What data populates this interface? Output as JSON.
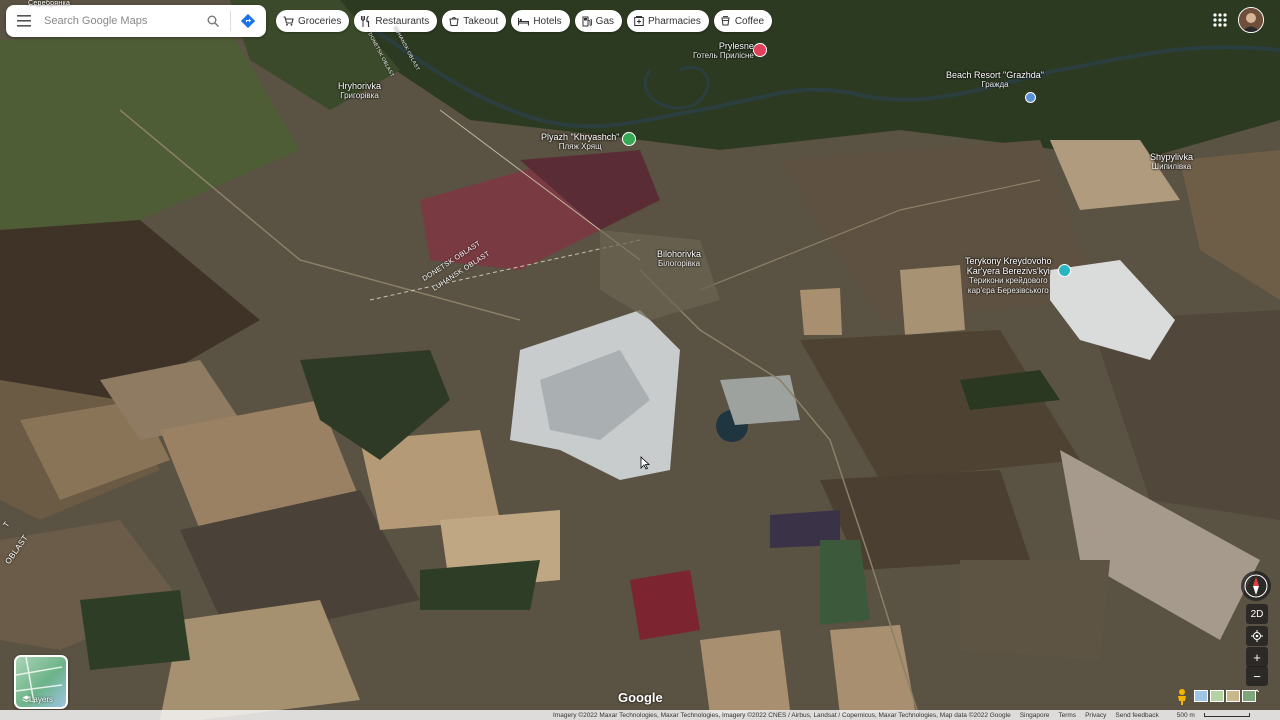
{
  "search": {
    "placeholder": "Search Google Maps"
  },
  "chips": [
    {
      "label": "Groceries",
      "icon": "cart-icon"
    },
    {
      "label": "Restaurants",
      "icon": "fork-knife-icon"
    },
    {
      "label": "Takeout",
      "icon": "takeout-icon"
    },
    {
      "label": "Hotels",
      "icon": "bed-icon"
    },
    {
      "label": "Gas",
      "icon": "gas-pump-icon"
    },
    {
      "label": "Pharmacies",
      "icon": "pharmacy-icon"
    },
    {
      "label": "Coffee",
      "icon": "cup-icon"
    }
  ],
  "places": {
    "hryhorivka": {
      "name": "Hryhorivka",
      "local": "Григорівка"
    },
    "prylesne": {
      "name": "Prylesne",
      "local": "Готель Прилісне"
    },
    "beach_resort": {
      "name": "Beach Resort \"Grazhda\"",
      "local": "Гражда"
    },
    "plyazh": {
      "name": "Plyazh \"Khryashch\"",
      "local": "Пляж Хрящ"
    },
    "shypylivka": {
      "name": "Shypylivka",
      "local": "Шипилівка"
    },
    "bilohorivka": {
      "name": "Bilohorivka",
      "local": "Білогорівка"
    },
    "terykony_line1": "Terykony Kreydovoho",
    "terykony_line2": "Kar'yera Berezivs'kyi",
    "terykony_local1": "Терикони крейдового",
    "terykony_local2": "кар'єра Березівського",
    "serebrianka": "Серебрянка"
  },
  "roads": {
    "donetsk": "DONETSK OBLAST",
    "luhansk": "LUHANSK OBLAST",
    "donetsk_top": "DONETSK OBLAST",
    "luhansk_top": "LUHANSK OBLAST",
    "edge": "OBLAST",
    "edge2": "T"
  },
  "layers": {
    "label": "Layers"
  },
  "logo": "Google",
  "controls": {
    "mode": "2D",
    "zoom_in": "+",
    "zoom_out": "−"
  },
  "footer": {
    "attribution": "Imagery ©2022 Maxar Technologies, Maxar Technologies, Imagery ©2022 CNES / Airbus, Landsat / Copernicus, Maxar Technologies, Map data ©2022 Google",
    "country": "Singapore",
    "terms": "Terms",
    "privacy": "Privacy",
    "feedback": "Send feedback",
    "scale": "500 m"
  },
  "colors": {
    "pin_red": "#e0405a",
    "pin_green": "#34a853",
    "pin_teal": "#2bb5c0",
    "pin_blue": "#5b8fd6"
  }
}
